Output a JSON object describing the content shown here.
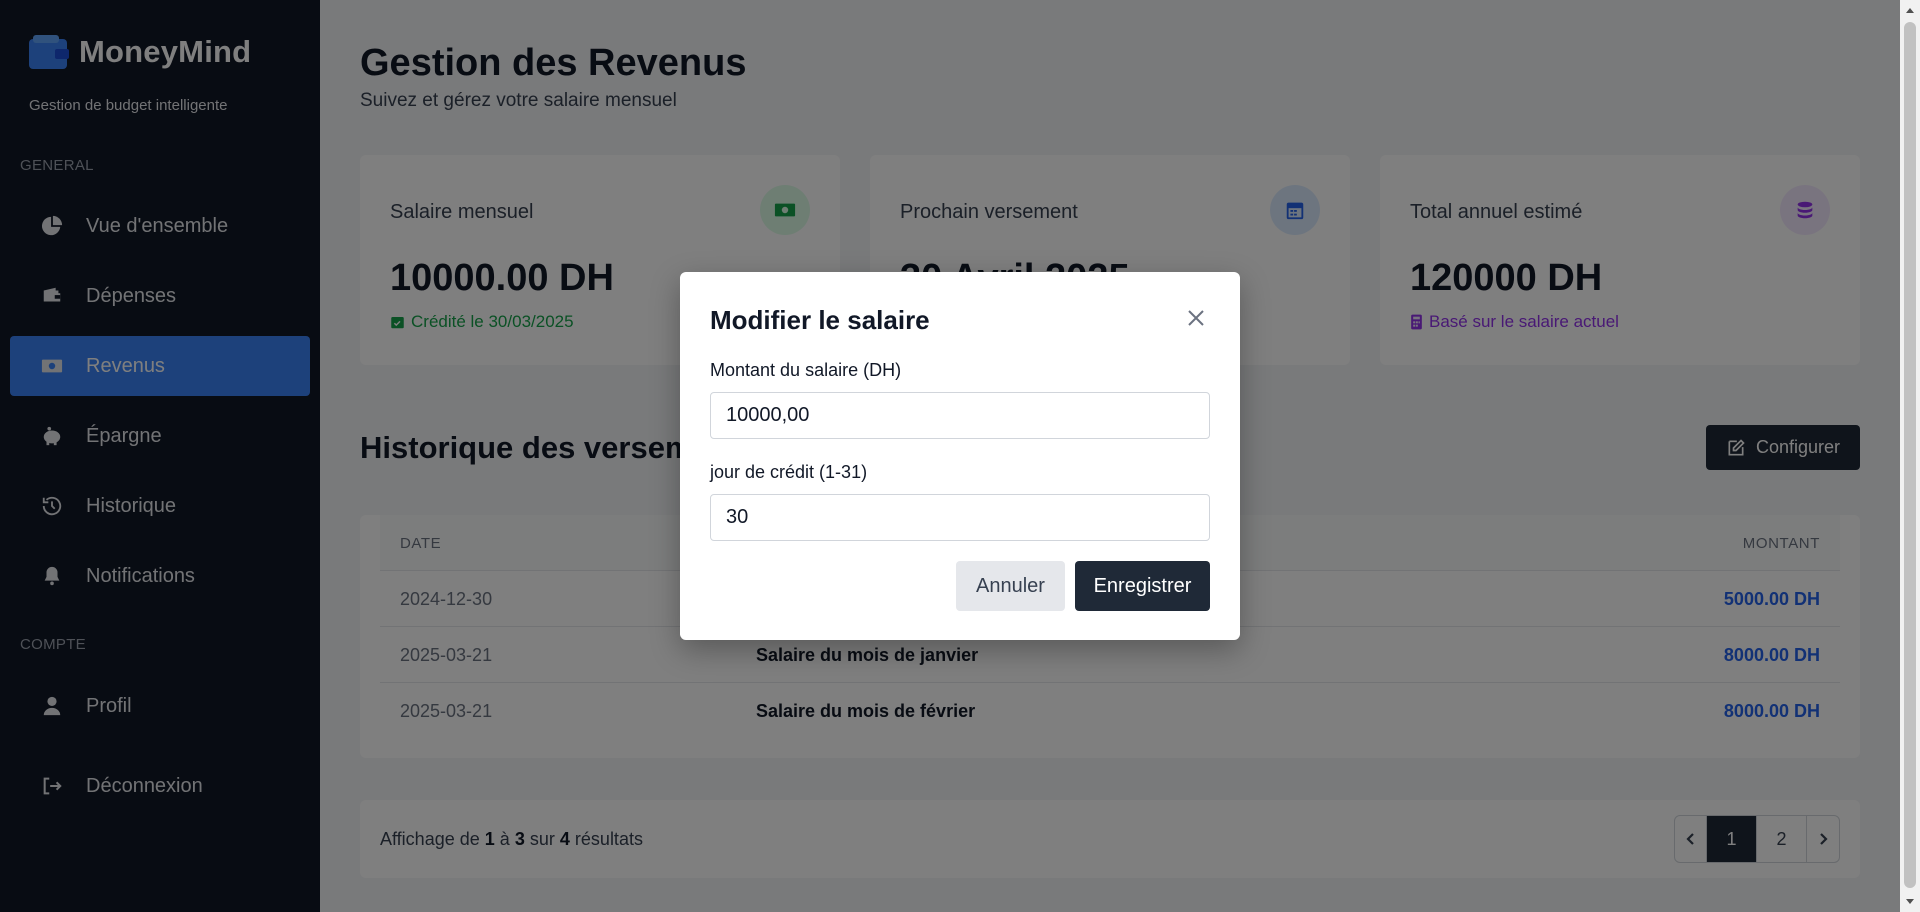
{
  "app": {
    "name": "MoneyMind",
    "tagline": "Gestion de budget intelligente"
  },
  "sidebar": {
    "sections": [
      {
        "title": "GENERAL",
        "items": [
          {
            "label": "Vue d'ensemble",
            "icon": "pie-chart-icon",
            "active": false
          },
          {
            "label": "Dépenses",
            "icon": "wallet-icon",
            "active": false
          },
          {
            "label": "Revenus",
            "icon": "money-bill-icon",
            "active": true
          },
          {
            "label": "Épargne",
            "icon": "piggy-bank-icon",
            "active": false
          },
          {
            "label": "Historique",
            "icon": "history-icon",
            "active": false
          },
          {
            "label": "Notifications",
            "icon": "bell-icon",
            "active": false
          }
        ]
      },
      {
        "title": "COMPTE",
        "items": [
          {
            "label": "Profil",
            "icon": "user-icon",
            "active": false
          },
          {
            "label": "Déconnexion",
            "icon": "logout-icon",
            "active": false
          }
        ]
      }
    ]
  },
  "header": {
    "title": "Gestion des Revenus",
    "subtitle": "Suivez et gérez votre salaire mensuel"
  },
  "cards": [
    {
      "label": "Salaire mensuel",
      "value": "10000.00 DH",
      "note": "Crédité le 30/03/2025",
      "note_color": "#16a34a",
      "icon": "money-bill-icon",
      "badge_bg": "#dcfce7",
      "icon_color": "#16a34a"
    },
    {
      "label": "Prochain versement",
      "value": "30 Avril 2025",
      "note": "",
      "note_color": "#2563eb",
      "icon": "calendar-icon",
      "badge_bg": "#dbeafe",
      "icon_color": "#2563eb"
    },
    {
      "label": "Total annuel estimé",
      "value": "120000 DH",
      "note": "Basé sur le salaire actuel",
      "note_color": "#9333ea",
      "icon": "coins-icon",
      "badge_bg": "#f3e8ff",
      "icon_color": "#9333ea"
    }
  ],
  "history": {
    "title": "Historique des versements",
    "configure_label": "Configurer",
    "columns": {
      "date": "DATE",
      "amount": "MONTANT"
    },
    "rows": [
      {
        "date": "2024-12-30",
        "description": "",
        "amount": "5000.00 DH"
      },
      {
        "date": "2025-03-21",
        "description": "Salaire du mois de janvier",
        "amount": "8000.00 DH"
      },
      {
        "date": "2025-03-21",
        "description": "Salaire du mois de février",
        "amount": "8000.00 DH"
      }
    ]
  },
  "pagination": {
    "prefix": "Affichage de",
    "from": "1",
    "to_word": "à",
    "to": "3",
    "of_word": "sur",
    "total": "4",
    "suffix": "résultats",
    "pages": [
      "1",
      "2"
    ],
    "current": "1"
  },
  "modal": {
    "title": "Modifier le salaire",
    "amount_label": "Montant du salaire (DH)",
    "amount_value": "10000,00",
    "day_label": "jour de crédit (1-31)",
    "day_value": "30",
    "cancel_label": "Annuler",
    "save_label": "Enregistrer"
  }
}
